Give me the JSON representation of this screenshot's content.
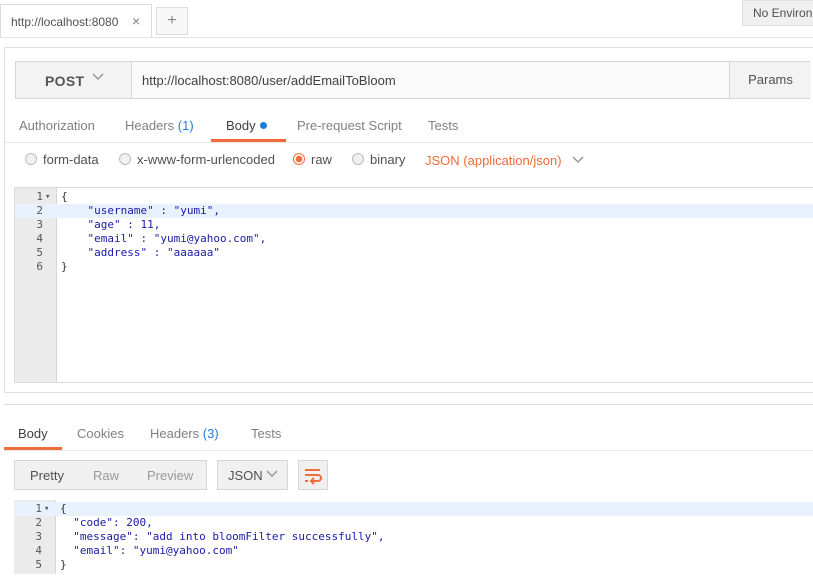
{
  "tabbar": {
    "tab_title": "http://localhost:8080",
    "close_glyph": "×",
    "add_glyph": "+",
    "environment": "No Environment"
  },
  "request": {
    "method": "POST",
    "url": "http://localhost:8080/user/addEmailToBloom",
    "params_label": "Params",
    "tabs": [
      {
        "label": "Authorization"
      },
      {
        "label": "Headers",
        "count": "(1)"
      },
      {
        "label": "Body",
        "has_dot": true
      },
      {
        "label": "Pre-request Script"
      },
      {
        "label": "Tests"
      }
    ],
    "active_tab": "Body",
    "body_types": [
      {
        "label": "form-data",
        "selected": false
      },
      {
        "label": "x-www-form-urlencoded",
        "selected": false
      },
      {
        "label": "raw",
        "selected": true
      },
      {
        "label": "binary",
        "selected": false
      }
    ],
    "content_type": "JSON (application/json)",
    "body_lines": [
      "{",
      "    \"username\" : \"yumi\",",
      "    \"age\" : 11,",
      "    \"email\" : \"yumi@yahoo.com\",",
      "    \"address\" : \"aaaaaa\"",
      "}"
    ]
  },
  "response": {
    "tabs": [
      {
        "label": "Body"
      },
      {
        "label": "Cookies"
      },
      {
        "label": "Headers",
        "count": "(3)"
      },
      {
        "label": "Tests"
      }
    ],
    "active_tab": "Body",
    "view_modes": [
      "Pretty",
      "Raw",
      "Preview"
    ],
    "active_view": "Pretty",
    "format": "JSON",
    "body_lines": [
      "{",
      "  \"code\": 200,",
      "  \"message\": \"add into bloomFilter successfully\",",
      "  \"email\": \"yumi@yahoo.com\"",
      "}"
    ]
  },
  "colors": {
    "accent": "#f26b3a",
    "count_blue": "#1f7bd8",
    "json_token": "#1a1aa6"
  },
  "icons": [
    "close-icon",
    "plus-icon",
    "chevron-down-icon",
    "wrap-lines-icon",
    "fold-arrow-icon"
  ]
}
